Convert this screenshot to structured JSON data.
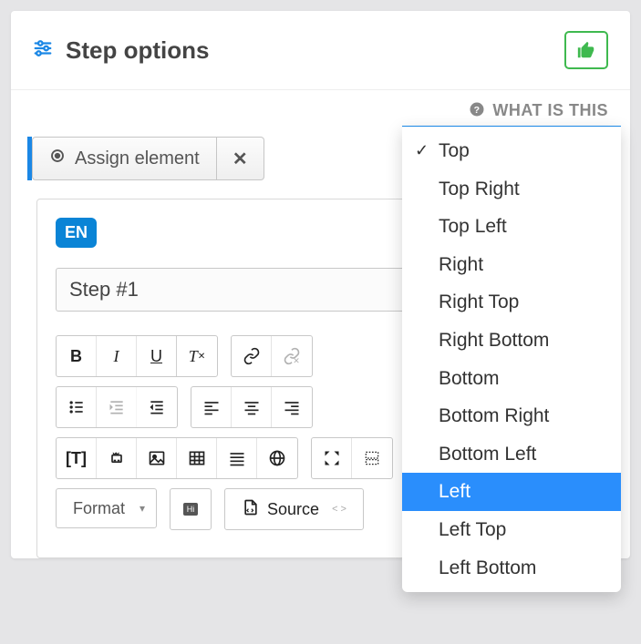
{
  "header": {
    "title": "Step options"
  },
  "whatis": "WHAT IS THIS",
  "assign": {
    "label": "Assign element"
  },
  "lang_badge": "EN",
  "step_title": "Step #1",
  "format_label": "Format",
  "source_label": "Source",
  "dropdown": {
    "items": [
      "Top",
      "Top Right",
      "Top Left",
      "Right",
      "Right Top",
      "Right Bottom",
      "Bottom",
      "Bottom Right",
      "Bottom Left",
      "Left",
      "Left Top",
      "Left Bottom"
    ],
    "checked": "Top",
    "selected": "Left"
  }
}
